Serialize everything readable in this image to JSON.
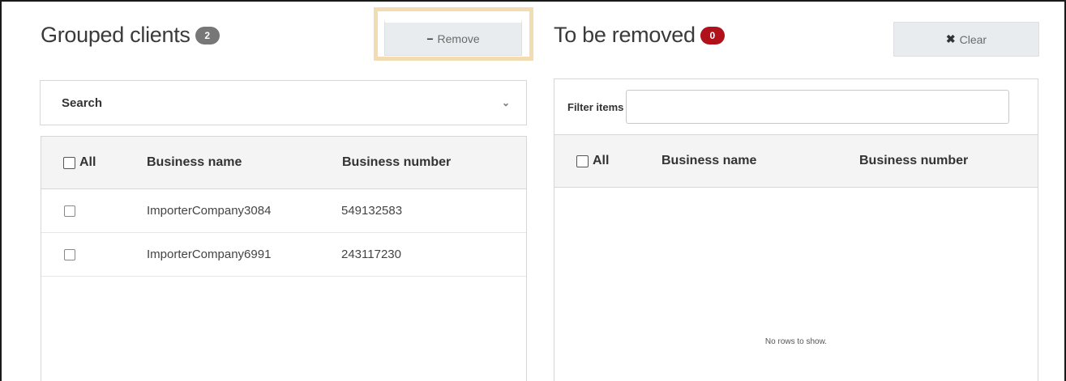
{
  "left_panel": {
    "title": "Grouped clients",
    "count": "2",
    "remove_button": {
      "label": "Remove",
      "icon": "minus-icon"
    },
    "search": {
      "label": "Search",
      "icon": "chevron-down-icon"
    },
    "table": {
      "select_all_label": "All",
      "columns": [
        "Business name",
        "Business number"
      ],
      "rows": [
        {
          "business_name": "ImporterCompany3084",
          "business_number": "549132583",
          "checked": false
        },
        {
          "business_name": "ImporterCompany6991",
          "business_number": "243117230",
          "checked": false
        }
      ]
    }
  },
  "right_panel": {
    "title": "To be removed",
    "count": "0",
    "clear_button": {
      "label": "Clear",
      "icon": "close-icon"
    },
    "filter": {
      "label": "Filter items",
      "value": ""
    },
    "table": {
      "select_all_label": "All",
      "columns": [
        "Business name",
        "Business number"
      ],
      "rows": [],
      "empty_message": "No rows to show."
    }
  },
  "colors": {
    "highlight": "#f3dbb2",
    "badge_grey": "#777777",
    "badge_red": "#b0111a"
  }
}
